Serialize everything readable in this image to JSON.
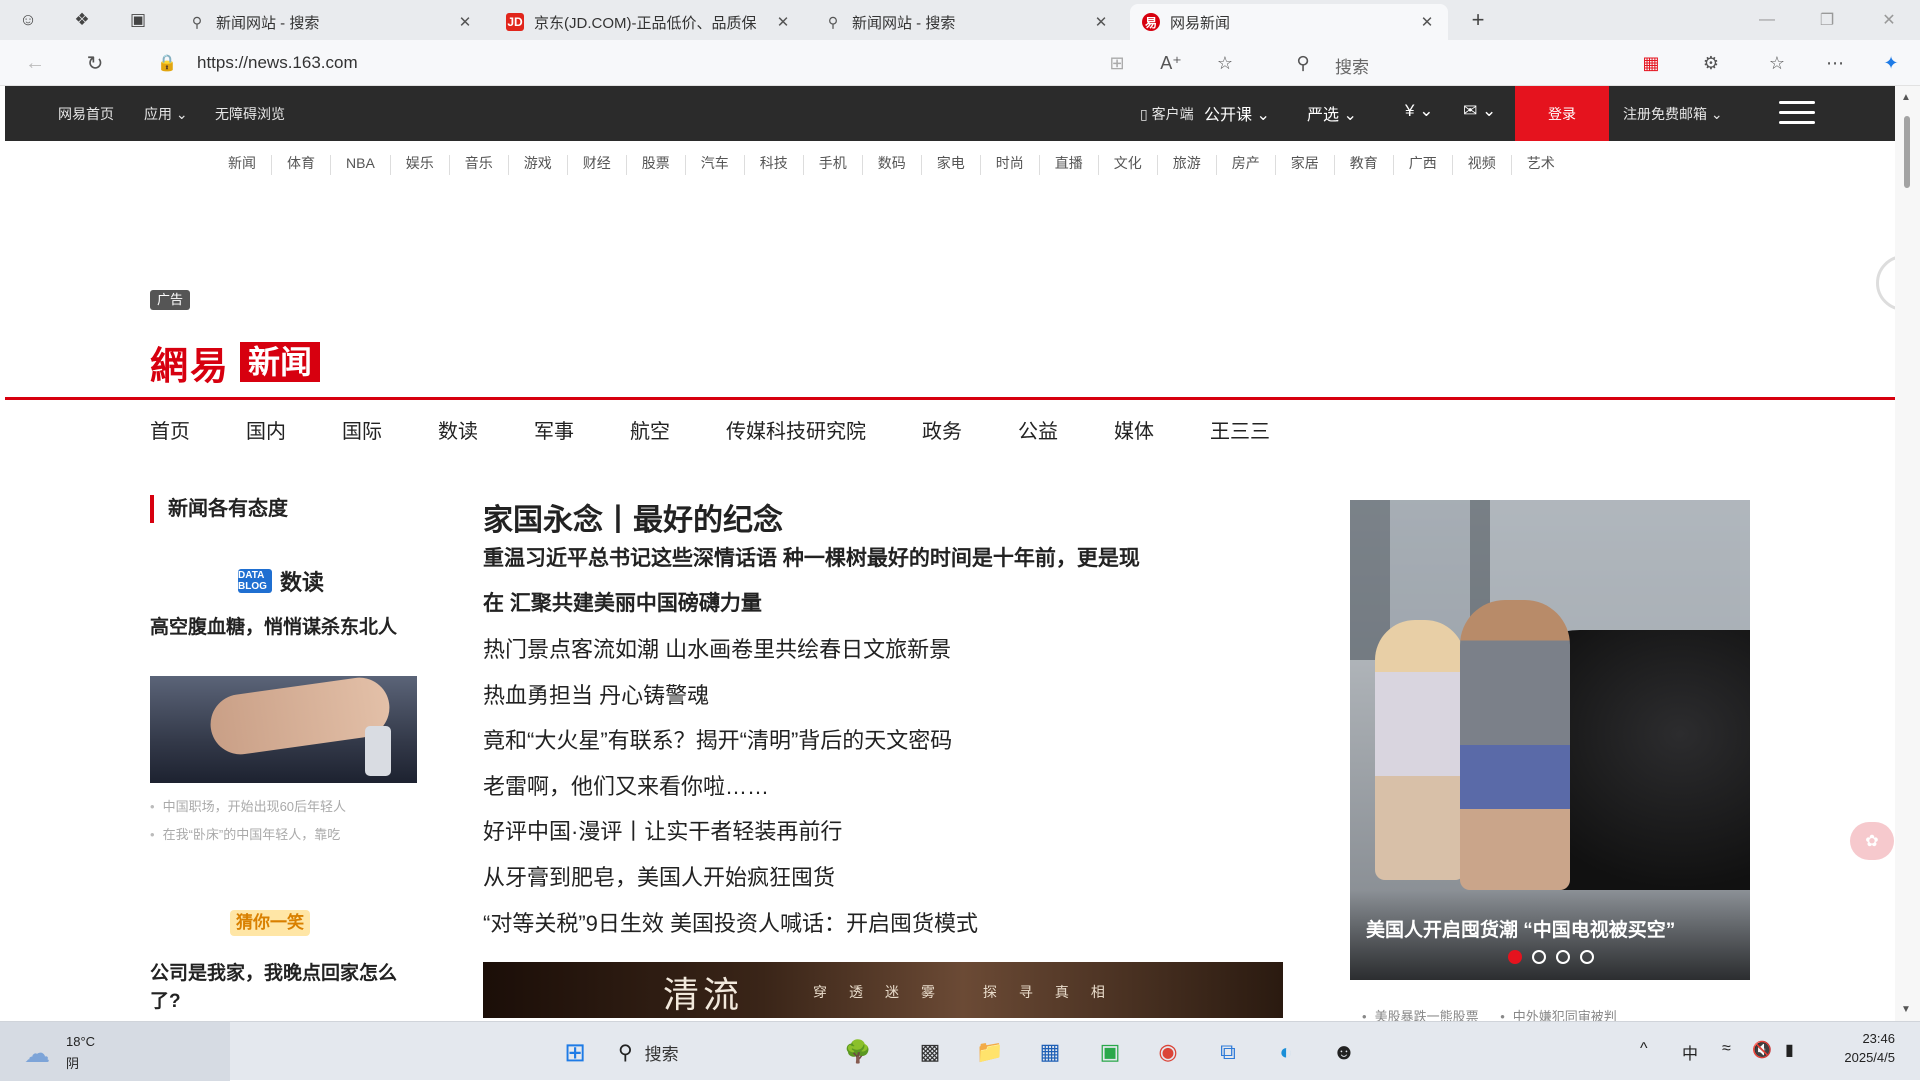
{
  "browser": {
    "tabs": [
      {
        "title": "新闻网站 - 搜索",
        "favicon": "search-icon",
        "active": false
      },
      {
        "title": "京东(JD.COM)-正品低价、品质保",
        "favicon": "jd-logo",
        "active": false
      },
      {
        "title": "新闻网站 - 搜索",
        "favicon": "search-icon",
        "active": false
      },
      {
        "title": "网易新闻",
        "favicon": "netease-logo",
        "active": true
      }
    ],
    "url": "https://news.163.com",
    "search_placeholder": "搜索"
  },
  "site_bar": {
    "left_links": [
      "网易首页",
      "应用",
      "无障碍浏览"
    ],
    "right_links": [
      "客户端",
      "公开课",
      "严选",
      "支付",
      "邮箱"
    ],
    "login": "登录",
    "register": "注册免费邮箱"
  },
  "channel_row": [
    "新闻",
    "体育",
    "NBA",
    "娱乐",
    "音乐",
    "游戏",
    "财经",
    "股票",
    "汽车",
    "科技",
    "手机",
    "数码",
    "家电",
    "时尚",
    "直播",
    "文化",
    "旅游",
    "房产",
    "家居",
    "教育",
    "广西",
    "视频",
    "艺术"
  ],
  "ad_label": "广告",
  "logo": {
    "netease": "網易",
    "news": "新闻"
  },
  "main_nav": [
    "首页",
    "国内",
    "国际",
    "数读",
    "军事",
    "航空",
    "传媒科技研究院",
    "政务",
    "公益",
    "媒体",
    "王三三"
  ],
  "left_column": {
    "section_title": "新闻各有态度",
    "brand_badge": "DATA BLOG",
    "brand_title": "数读",
    "story1_title": "高空腹血糖，悄悄谋杀东北人",
    "bullets": [
      "中国职场，开始出现60后年轻人",
      "在我“卧床”的中国年轻人，靠吃"
    ],
    "promo": "猜你一笑",
    "story2_title": "公司是我家，我晚点回家怎么了?"
  },
  "center_column": {
    "headline": "家国永念丨最好的纪念",
    "sub_head_line1": "重温习近平总书记这些深情话语    种一棵树最好的时间是十年前，更是现",
    "sub_head_line2": "在    汇聚共建美丽中国磅礴力量",
    "news": [
      "热门景点客流如潮 山水画卷里共绘春日文旅新景",
      "热血勇担当 丹心铸警魂",
      "竟和“大火星”有联系？揭开“清明”背后的天文密码",
      "老雷啊，他们又来看你啦……",
      "好评中国·漫评丨让实干者轻装再前行",
      "从牙膏到肥皂，美国人开始疯狂囤货",
      "“对等关税”9日生效 美国投资人喊话：开启囤货模式"
    ],
    "banner_big": "清流",
    "banner_small": "穿透迷雾  探寻真相"
  },
  "right_column": {
    "carousel_caption": "美国人开启囤货潮  “中国电视被买空”",
    "carousel_dots": 4,
    "carousel_active": 0,
    "bullets": [
      "美股暴跌一熊股票",
      "中外嫌犯同审被判"
    ]
  },
  "taskbar": {
    "weather_temp": "18°C",
    "weather_cond": "阴",
    "search": "搜索",
    "ime": "中",
    "time": "23:46",
    "date": "2025/4/5"
  },
  "colors": {
    "brand_red": "#d7000f",
    "login_red": "#e5131e",
    "topbar": "#2b2b2b"
  }
}
